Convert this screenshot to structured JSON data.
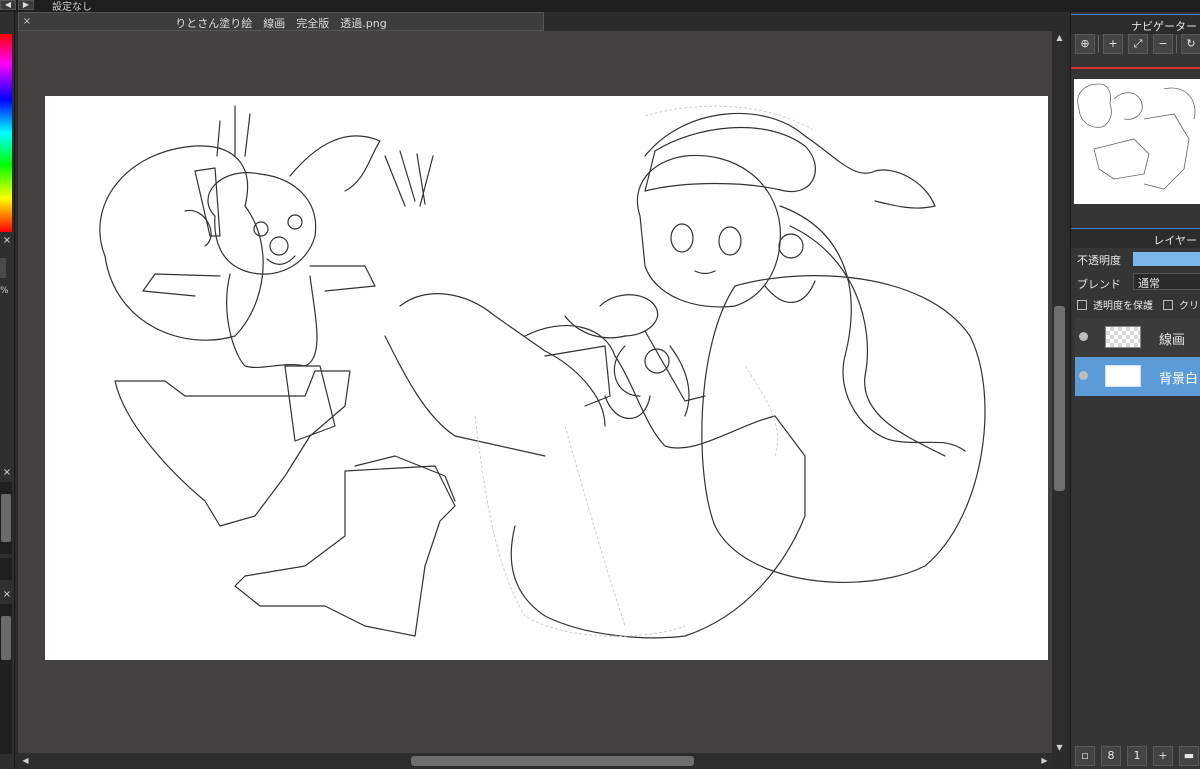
{
  "app": {
    "top_label": "設定なし",
    "undo_icon": "undo-icon",
    "redo_icon": "redo-icon"
  },
  "document": {
    "tab_title": "りとさん塗り絵　線画　完全版　透過.png",
    "close_glyph": "×"
  },
  "left_strip": {
    "percent_text": "%",
    "close_glyph": "×"
  },
  "navigator": {
    "title": "ナビゲーター",
    "tools": [
      {
        "name": "zoom-actual-icon",
        "glyph": "⊕"
      },
      {
        "name": "zoom-in-icon",
        "glyph": "+"
      },
      {
        "name": "fit-screen-icon",
        "glyph": "⤢"
      },
      {
        "name": "zoom-out-icon",
        "glyph": "−"
      },
      {
        "name": "rotate-icon",
        "glyph": "↻"
      }
    ]
  },
  "layers_panel": {
    "title": "レイヤー",
    "opacity_label": "不透明度",
    "blend_label": "ブレンド",
    "blend_value": "通常",
    "protect_alpha_label": "透明度を保護",
    "clip_label": "クリ",
    "layers": [
      {
        "name": "線画",
        "selected": false,
        "thumb": "transparent"
      },
      {
        "name": "背景白",
        "selected": true,
        "thumb": "white"
      }
    ],
    "selected_color": "#5a9bd8"
  },
  "bottom_tools": [
    {
      "name": "new-layer-icon",
      "glyph": "▫"
    },
    {
      "name": "new-8bit-layer-icon",
      "glyph": "8"
    },
    {
      "name": "new-1bit-layer-icon",
      "glyph": "1"
    },
    {
      "name": "add-special-layer-icon",
      "glyph": "+"
    },
    {
      "name": "new-folder-icon",
      "glyph": "▬"
    }
  ]
}
